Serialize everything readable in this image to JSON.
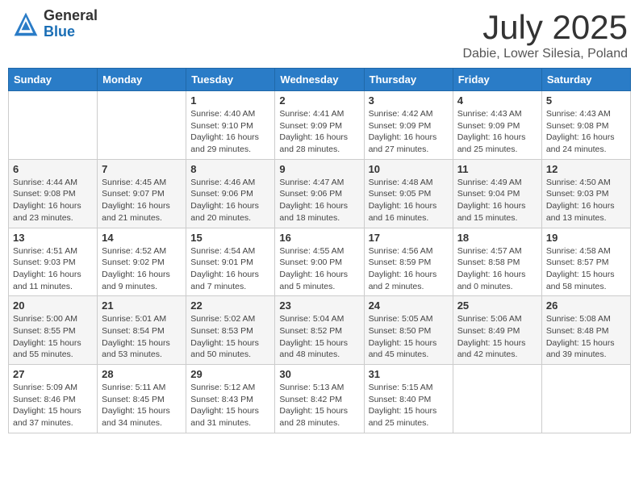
{
  "header": {
    "logo_general": "General",
    "logo_blue": "Blue",
    "month_title": "July 2025",
    "location": "Dabie, Lower Silesia, Poland"
  },
  "weekdays": [
    "Sunday",
    "Monday",
    "Tuesday",
    "Wednesday",
    "Thursday",
    "Friday",
    "Saturday"
  ],
  "weeks": [
    [
      {
        "day": "",
        "info": ""
      },
      {
        "day": "",
        "info": ""
      },
      {
        "day": "1",
        "info": "Sunrise: 4:40 AM\nSunset: 9:10 PM\nDaylight: 16 hours and 29 minutes."
      },
      {
        "day": "2",
        "info": "Sunrise: 4:41 AM\nSunset: 9:09 PM\nDaylight: 16 hours and 28 minutes."
      },
      {
        "day": "3",
        "info": "Sunrise: 4:42 AM\nSunset: 9:09 PM\nDaylight: 16 hours and 27 minutes."
      },
      {
        "day": "4",
        "info": "Sunrise: 4:43 AM\nSunset: 9:09 PM\nDaylight: 16 hours and 25 minutes."
      },
      {
        "day": "5",
        "info": "Sunrise: 4:43 AM\nSunset: 9:08 PM\nDaylight: 16 hours and 24 minutes."
      }
    ],
    [
      {
        "day": "6",
        "info": "Sunrise: 4:44 AM\nSunset: 9:08 PM\nDaylight: 16 hours and 23 minutes."
      },
      {
        "day": "7",
        "info": "Sunrise: 4:45 AM\nSunset: 9:07 PM\nDaylight: 16 hours and 21 minutes."
      },
      {
        "day": "8",
        "info": "Sunrise: 4:46 AM\nSunset: 9:06 PM\nDaylight: 16 hours and 20 minutes."
      },
      {
        "day": "9",
        "info": "Sunrise: 4:47 AM\nSunset: 9:06 PM\nDaylight: 16 hours and 18 minutes."
      },
      {
        "day": "10",
        "info": "Sunrise: 4:48 AM\nSunset: 9:05 PM\nDaylight: 16 hours and 16 minutes."
      },
      {
        "day": "11",
        "info": "Sunrise: 4:49 AM\nSunset: 9:04 PM\nDaylight: 16 hours and 15 minutes."
      },
      {
        "day": "12",
        "info": "Sunrise: 4:50 AM\nSunset: 9:03 PM\nDaylight: 16 hours and 13 minutes."
      }
    ],
    [
      {
        "day": "13",
        "info": "Sunrise: 4:51 AM\nSunset: 9:03 PM\nDaylight: 16 hours and 11 minutes."
      },
      {
        "day": "14",
        "info": "Sunrise: 4:52 AM\nSunset: 9:02 PM\nDaylight: 16 hours and 9 minutes."
      },
      {
        "day": "15",
        "info": "Sunrise: 4:54 AM\nSunset: 9:01 PM\nDaylight: 16 hours and 7 minutes."
      },
      {
        "day": "16",
        "info": "Sunrise: 4:55 AM\nSunset: 9:00 PM\nDaylight: 16 hours and 5 minutes."
      },
      {
        "day": "17",
        "info": "Sunrise: 4:56 AM\nSunset: 8:59 PM\nDaylight: 16 hours and 2 minutes."
      },
      {
        "day": "18",
        "info": "Sunrise: 4:57 AM\nSunset: 8:58 PM\nDaylight: 16 hours and 0 minutes."
      },
      {
        "day": "19",
        "info": "Sunrise: 4:58 AM\nSunset: 8:57 PM\nDaylight: 15 hours and 58 minutes."
      }
    ],
    [
      {
        "day": "20",
        "info": "Sunrise: 5:00 AM\nSunset: 8:55 PM\nDaylight: 15 hours and 55 minutes."
      },
      {
        "day": "21",
        "info": "Sunrise: 5:01 AM\nSunset: 8:54 PM\nDaylight: 15 hours and 53 minutes."
      },
      {
        "day": "22",
        "info": "Sunrise: 5:02 AM\nSunset: 8:53 PM\nDaylight: 15 hours and 50 minutes."
      },
      {
        "day": "23",
        "info": "Sunrise: 5:04 AM\nSunset: 8:52 PM\nDaylight: 15 hours and 48 minutes."
      },
      {
        "day": "24",
        "info": "Sunrise: 5:05 AM\nSunset: 8:50 PM\nDaylight: 15 hours and 45 minutes."
      },
      {
        "day": "25",
        "info": "Sunrise: 5:06 AM\nSunset: 8:49 PM\nDaylight: 15 hours and 42 minutes."
      },
      {
        "day": "26",
        "info": "Sunrise: 5:08 AM\nSunset: 8:48 PM\nDaylight: 15 hours and 39 minutes."
      }
    ],
    [
      {
        "day": "27",
        "info": "Sunrise: 5:09 AM\nSunset: 8:46 PM\nDaylight: 15 hours and 37 minutes."
      },
      {
        "day": "28",
        "info": "Sunrise: 5:11 AM\nSunset: 8:45 PM\nDaylight: 15 hours and 34 minutes."
      },
      {
        "day": "29",
        "info": "Sunrise: 5:12 AM\nSunset: 8:43 PM\nDaylight: 15 hours and 31 minutes."
      },
      {
        "day": "30",
        "info": "Sunrise: 5:13 AM\nSunset: 8:42 PM\nDaylight: 15 hours and 28 minutes."
      },
      {
        "day": "31",
        "info": "Sunrise: 5:15 AM\nSunset: 8:40 PM\nDaylight: 15 hours and 25 minutes."
      },
      {
        "day": "",
        "info": ""
      },
      {
        "day": "",
        "info": ""
      }
    ]
  ]
}
